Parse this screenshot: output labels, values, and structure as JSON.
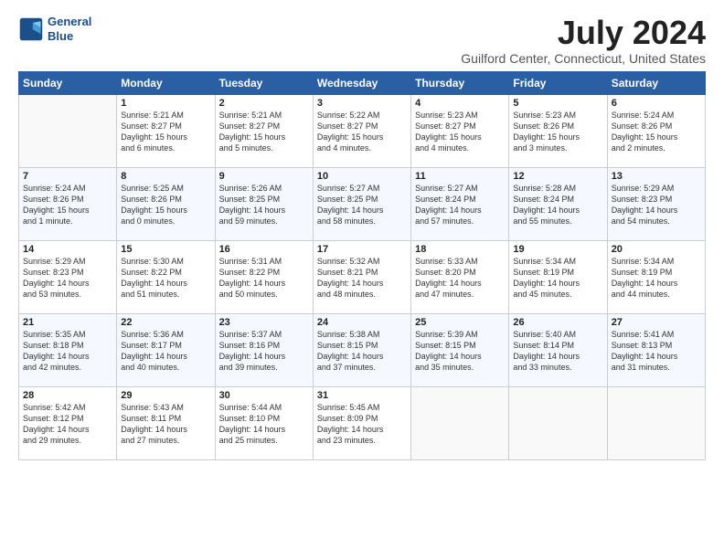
{
  "header": {
    "logo_line1": "General",
    "logo_line2": "Blue",
    "title": "July 2024",
    "location": "Guilford Center, Connecticut, United States"
  },
  "weekdays": [
    "Sunday",
    "Monday",
    "Tuesday",
    "Wednesday",
    "Thursday",
    "Friday",
    "Saturday"
  ],
  "weeks": [
    [
      {
        "day": "",
        "info": ""
      },
      {
        "day": "1",
        "info": "Sunrise: 5:21 AM\nSunset: 8:27 PM\nDaylight: 15 hours\nand 6 minutes."
      },
      {
        "day": "2",
        "info": "Sunrise: 5:21 AM\nSunset: 8:27 PM\nDaylight: 15 hours\nand 5 minutes."
      },
      {
        "day": "3",
        "info": "Sunrise: 5:22 AM\nSunset: 8:27 PM\nDaylight: 15 hours\nand 4 minutes."
      },
      {
        "day": "4",
        "info": "Sunrise: 5:23 AM\nSunset: 8:27 PM\nDaylight: 15 hours\nand 4 minutes."
      },
      {
        "day": "5",
        "info": "Sunrise: 5:23 AM\nSunset: 8:26 PM\nDaylight: 15 hours\nand 3 minutes."
      },
      {
        "day": "6",
        "info": "Sunrise: 5:24 AM\nSunset: 8:26 PM\nDaylight: 15 hours\nand 2 minutes."
      }
    ],
    [
      {
        "day": "7",
        "info": "Sunrise: 5:24 AM\nSunset: 8:26 PM\nDaylight: 15 hours\nand 1 minute."
      },
      {
        "day": "8",
        "info": "Sunrise: 5:25 AM\nSunset: 8:26 PM\nDaylight: 15 hours\nand 0 minutes."
      },
      {
        "day": "9",
        "info": "Sunrise: 5:26 AM\nSunset: 8:25 PM\nDaylight: 14 hours\nand 59 minutes."
      },
      {
        "day": "10",
        "info": "Sunrise: 5:27 AM\nSunset: 8:25 PM\nDaylight: 14 hours\nand 58 minutes."
      },
      {
        "day": "11",
        "info": "Sunrise: 5:27 AM\nSunset: 8:24 PM\nDaylight: 14 hours\nand 57 minutes."
      },
      {
        "day": "12",
        "info": "Sunrise: 5:28 AM\nSunset: 8:24 PM\nDaylight: 14 hours\nand 55 minutes."
      },
      {
        "day": "13",
        "info": "Sunrise: 5:29 AM\nSunset: 8:23 PM\nDaylight: 14 hours\nand 54 minutes."
      }
    ],
    [
      {
        "day": "14",
        "info": "Sunrise: 5:29 AM\nSunset: 8:23 PM\nDaylight: 14 hours\nand 53 minutes."
      },
      {
        "day": "15",
        "info": "Sunrise: 5:30 AM\nSunset: 8:22 PM\nDaylight: 14 hours\nand 51 minutes."
      },
      {
        "day": "16",
        "info": "Sunrise: 5:31 AM\nSunset: 8:22 PM\nDaylight: 14 hours\nand 50 minutes."
      },
      {
        "day": "17",
        "info": "Sunrise: 5:32 AM\nSunset: 8:21 PM\nDaylight: 14 hours\nand 48 minutes."
      },
      {
        "day": "18",
        "info": "Sunrise: 5:33 AM\nSunset: 8:20 PM\nDaylight: 14 hours\nand 47 minutes."
      },
      {
        "day": "19",
        "info": "Sunrise: 5:34 AM\nSunset: 8:19 PM\nDaylight: 14 hours\nand 45 minutes."
      },
      {
        "day": "20",
        "info": "Sunrise: 5:34 AM\nSunset: 8:19 PM\nDaylight: 14 hours\nand 44 minutes."
      }
    ],
    [
      {
        "day": "21",
        "info": "Sunrise: 5:35 AM\nSunset: 8:18 PM\nDaylight: 14 hours\nand 42 minutes."
      },
      {
        "day": "22",
        "info": "Sunrise: 5:36 AM\nSunset: 8:17 PM\nDaylight: 14 hours\nand 40 minutes."
      },
      {
        "day": "23",
        "info": "Sunrise: 5:37 AM\nSunset: 8:16 PM\nDaylight: 14 hours\nand 39 minutes."
      },
      {
        "day": "24",
        "info": "Sunrise: 5:38 AM\nSunset: 8:15 PM\nDaylight: 14 hours\nand 37 minutes."
      },
      {
        "day": "25",
        "info": "Sunrise: 5:39 AM\nSunset: 8:15 PM\nDaylight: 14 hours\nand 35 minutes."
      },
      {
        "day": "26",
        "info": "Sunrise: 5:40 AM\nSunset: 8:14 PM\nDaylight: 14 hours\nand 33 minutes."
      },
      {
        "day": "27",
        "info": "Sunrise: 5:41 AM\nSunset: 8:13 PM\nDaylight: 14 hours\nand 31 minutes."
      }
    ],
    [
      {
        "day": "28",
        "info": "Sunrise: 5:42 AM\nSunset: 8:12 PM\nDaylight: 14 hours\nand 29 minutes."
      },
      {
        "day": "29",
        "info": "Sunrise: 5:43 AM\nSunset: 8:11 PM\nDaylight: 14 hours\nand 27 minutes."
      },
      {
        "day": "30",
        "info": "Sunrise: 5:44 AM\nSunset: 8:10 PM\nDaylight: 14 hours\nand 25 minutes."
      },
      {
        "day": "31",
        "info": "Sunrise: 5:45 AM\nSunset: 8:09 PM\nDaylight: 14 hours\nand 23 minutes."
      },
      {
        "day": "",
        "info": ""
      },
      {
        "day": "",
        "info": ""
      },
      {
        "day": "",
        "info": ""
      }
    ]
  ]
}
